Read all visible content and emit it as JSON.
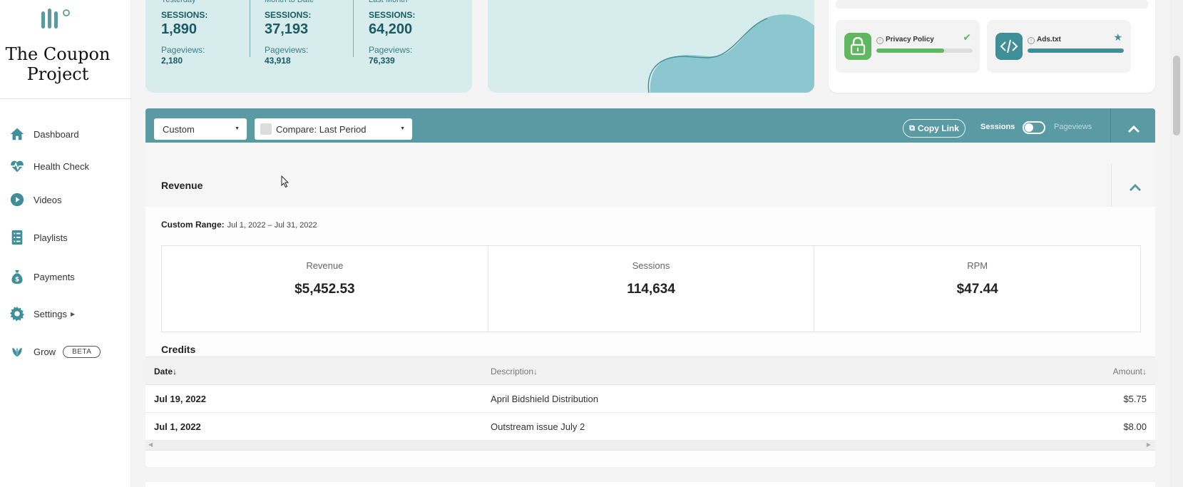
{
  "app": {
    "brand": "The Coupon Project"
  },
  "sidebar": {
    "items": [
      {
        "label": "Dashboard",
        "icon": "home-icon"
      },
      {
        "label": "Health Check",
        "icon": "heartbeat-icon"
      },
      {
        "label": "Videos",
        "icon": "play-icon"
      },
      {
        "label": "Playlists",
        "icon": "list-icon"
      },
      {
        "label": "Payments",
        "icon": "money-bag-icon"
      },
      {
        "label": "Settings",
        "icon": "gear-icon"
      },
      {
        "label": "Grow",
        "icon": "leaf-icon",
        "badge": "BETA"
      }
    ]
  },
  "stats": [
    {
      "period": "Yesterday",
      "sessions_label": "SESSIONS:",
      "sessions": "1,890",
      "pageviews_label": "Pageviews:",
      "pageviews": "2,180"
    },
    {
      "period": "Month to Date",
      "sessions_label": "SESSIONS:",
      "sessions": "37,193",
      "pageviews_label": "Pageviews:",
      "pageviews": "43,918"
    },
    {
      "period": "Last Month",
      "sessions_label": "SESSIONS:",
      "sessions": "64,200",
      "pageviews_label": "Pageviews:",
      "pageviews": "76,339"
    }
  ],
  "health": {
    "checks": [
      {
        "name": "Privacy Policy",
        "icon": "lock-icon",
        "status_icon": "checkmark-icon",
        "progress": 0.7,
        "color": "#5fb85f"
      },
      {
        "name": "Ads.txt",
        "icon": "code-icon",
        "status_icon": "star-icon",
        "progress": 1.0,
        "color": "#3f8f98"
      }
    ]
  },
  "filters": {
    "range_select": "Custom",
    "compare_select": "Compare: Last Period",
    "copy_link": "Copy Link",
    "toggle_left": "Sessions",
    "toggle_right": "Pageviews"
  },
  "revenue": {
    "title": "Revenue",
    "range_label": "Custom Range:",
    "range_value": "Jul 1, 2022 – Jul 31, 2022",
    "kpis": [
      {
        "label": "Revenue",
        "value": "$5,452.53"
      },
      {
        "label": "Sessions",
        "value": "114,634"
      },
      {
        "label": "RPM",
        "value": "$47.44"
      }
    ],
    "credits_title": "Credits",
    "columns": {
      "date": "Date",
      "description": "Description",
      "amount": "Amount"
    },
    "rows": [
      {
        "date": "Jul 19, 2022",
        "description": "April Bidshield Distribution",
        "amount": "$5.75"
      },
      {
        "date": "Jul 1, 2022",
        "description": "Outstream issue July 2",
        "amount": "$8.00"
      }
    ]
  },
  "colors": {
    "teal": "#5a9aa2",
    "teal_light": "#d6eced",
    "teal_dark": "#1a5a63",
    "green": "#5fb85f"
  }
}
